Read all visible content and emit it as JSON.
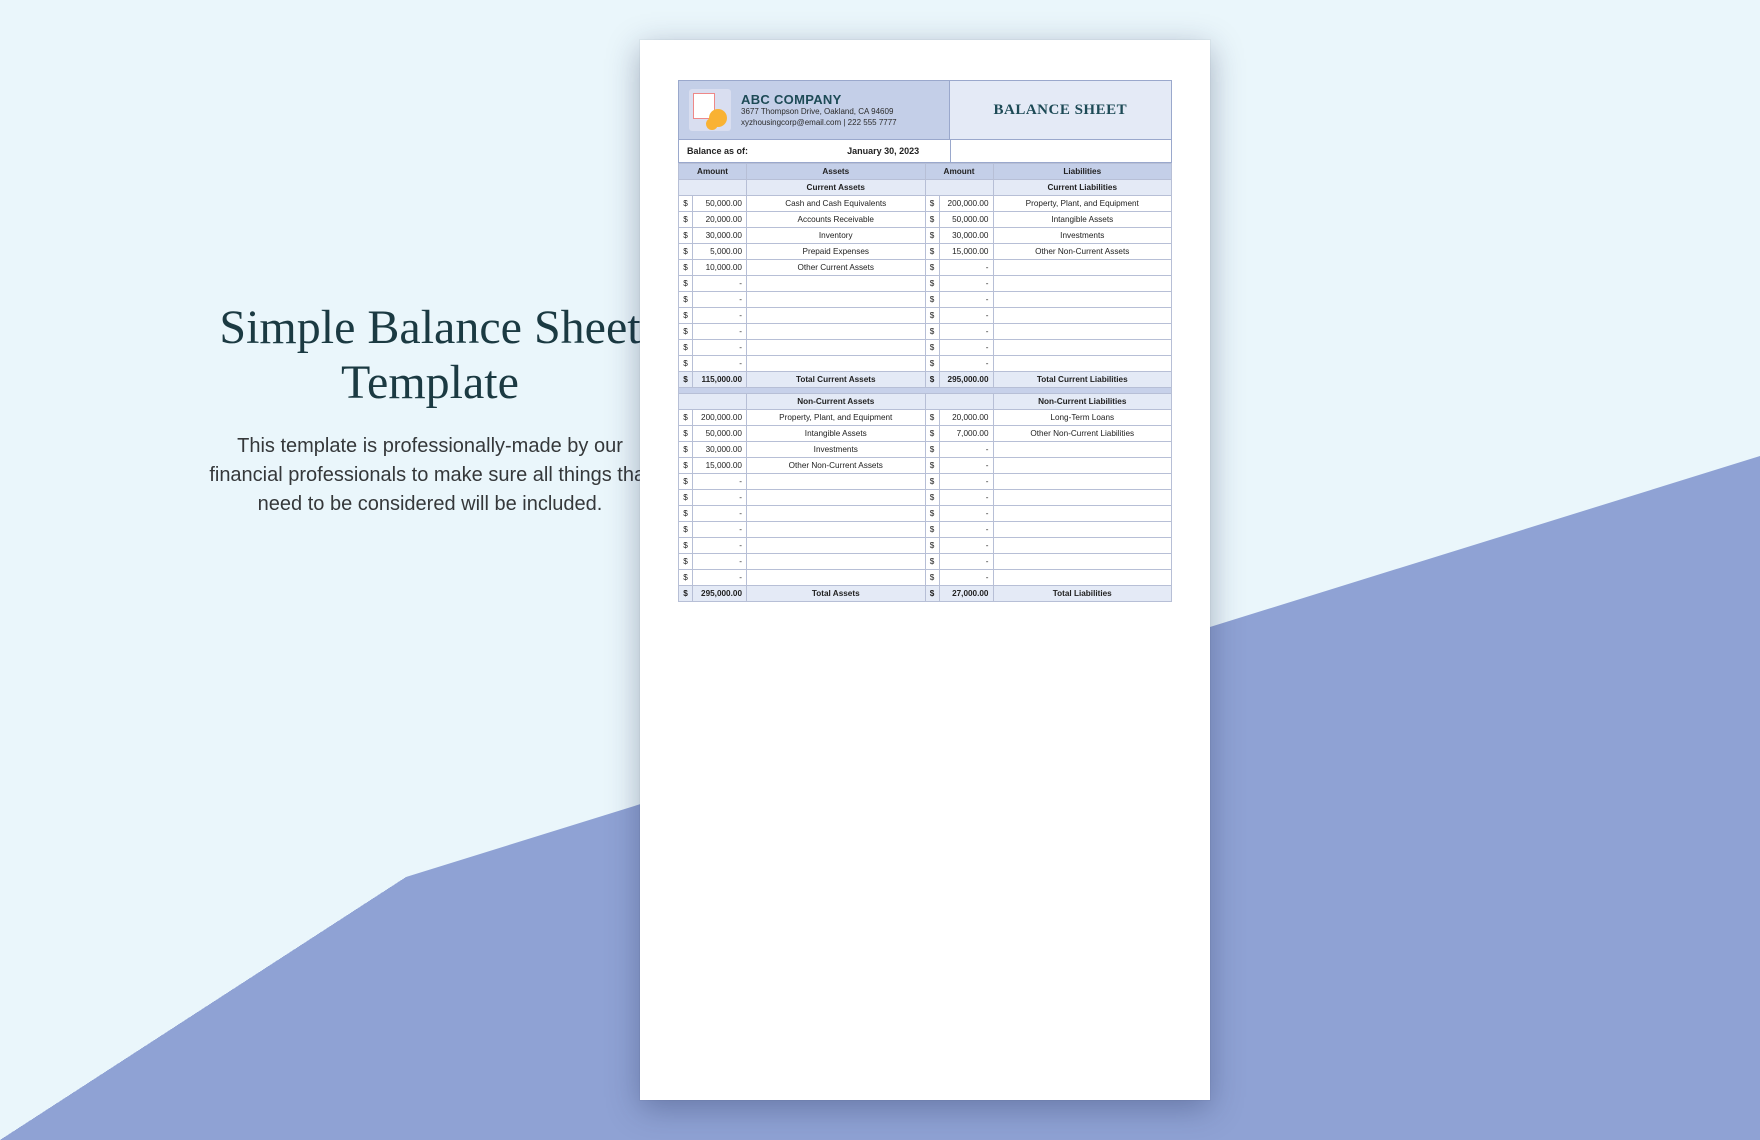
{
  "hero": {
    "title": "Simple Balance Sheet Template",
    "subtitle": "This template is professionally-made by our financial professionals to make sure all things that need to be considered will be included."
  },
  "doc": {
    "company_name": "ABC COMPANY",
    "address": "3677 Thompson Drive, Oakland, CA 94609",
    "contact": "xyzhousingcorp@email.com | 222 555 7777",
    "title": "BALANCE SHEET",
    "balance_asof_label": "Balance as of:",
    "balance_asof_value": "January 30, 2023",
    "col_amount": "Amount",
    "col_assets": "Assets",
    "col_liabilities": "Liabilities",
    "currency": "$",
    "dash": "-"
  },
  "sections": {
    "s1": {
      "head_left": "Current Assets",
      "head_right": "Current Liabilities",
      "rows": [
        {
          "la": "50,000.00",
          "ll": "Cash and Cash Equivalents",
          "ra": "200,000.00",
          "rl": "Property, Plant, and Equipment"
        },
        {
          "la": "20,000.00",
          "ll": "Accounts Receivable",
          "ra": "50,000.00",
          "rl": "Intangible Assets"
        },
        {
          "la": "30,000.00",
          "ll": "Inventory",
          "ra": "30,000.00",
          "rl": "Investments"
        },
        {
          "la": "5,000.00",
          "ll": "Prepaid Expenses",
          "ra": "15,000.00",
          "rl": "Other Non-Current Assets"
        },
        {
          "la": "10,000.00",
          "ll": "Other Current Assets",
          "ra": "-",
          "rl": ""
        },
        {
          "la": "-",
          "ll": "",
          "ra": "-",
          "rl": ""
        },
        {
          "la": "-",
          "ll": "",
          "ra": "-",
          "rl": ""
        },
        {
          "la": "-",
          "ll": "",
          "ra": "-",
          "rl": ""
        },
        {
          "la": "-",
          "ll": "",
          "ra": "-",
          "rl": ""
        },
        {
          "la": "-",
          "ll": "",
          "ra": "-",
          "rl": ""
        },
        {
          "la": "-",
          "ll": "",
          "ra": "-",
          "rl": ""
        }
      ],
      "total": {
        "la": "115,000.00",
        "ll": "Total Current Assets",
        "ra": "295,000.00",
        "rl": "Total Current Liabilities"
      }
    },
    "s2": {
      "head_left": "Non-Current Assets",
      "head_right": "Non-Current Liabilities",
      "rows": [
        {
          "la": "200,000.00",
          "ll": "Property, Plant, and Equipment",
          "ra": "20,000.00",
          "rl": "Long-Term Loans"
        },
        {
          "la": "50,000.00",
          "ll": "Intangible Assets",
          "ra": "7,000.00",
          "rl": "Other Non-Current Liabilities"
        },
        {
          "la": "30,000.00",
          "ll": "Investments",
          "ra": "-",
          "rl": ""
        },
        {
          "la": "15,000.00",
          "ll": "Other Non-Current Assets",
          "ra": "-",
          "rl": ""
        },
        {
          "la": "-",
          "ll": "",
          "ra": "-",
          "rl": ""
        },
        {
          "la": "-",
          "ll": "",
          "ra": "-",
          "rl": ""
        },
        {
          "la": "-",
          "ll": "",
          "ra": "-",
          "rl": ""
        },
        {
          "la": "-",
          "ll": "",
          "ra": "-",
          "rl": ""
        },
        {
          "la": "-",
          "ll": "",
          "ra": "-",
          "rl": ""
        },
        {
          "la": "-",
          "ll": "",
          "ra": "-",
          "rl": ""
        },
        {
          "la": "-",
          "ll": "",
          "ra": "-",
          "rl": ""
        }
      ],
      "total": {
        "la": "295,000.00",
        "ll": "Total Assets",
        "ra": "27,000.00",
        "rl": "Total Liabilities"
      }
    }
  }
}
